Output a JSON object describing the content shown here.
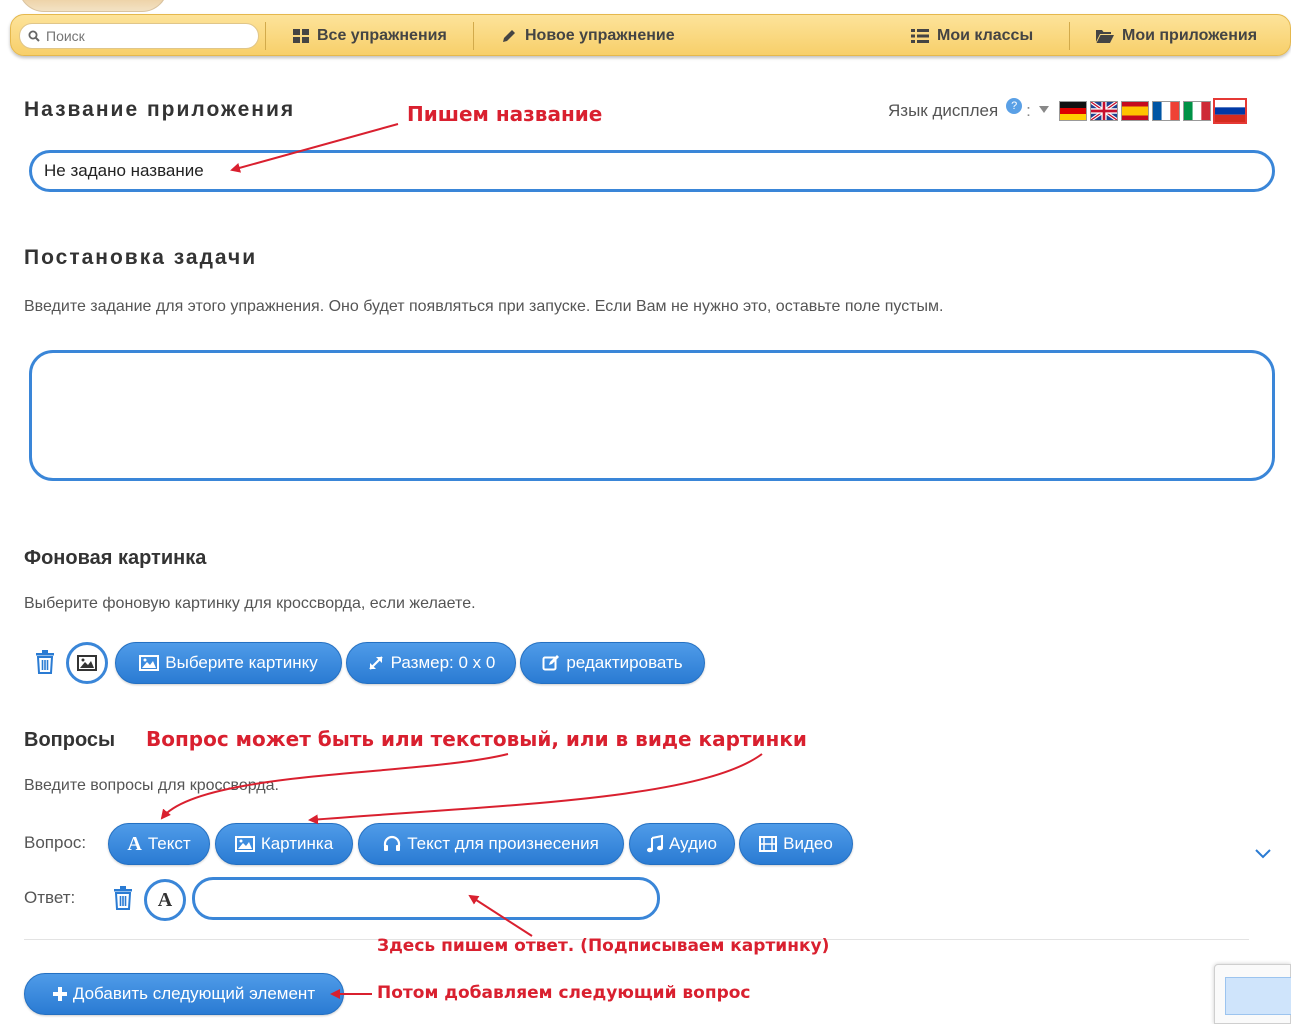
{
  "nav": {
    "search_placeholder": "Поиск",
    "all_exercises": "Все упражнения",
    "new_exercise": "Новое упражнение",
    "my_classes": "Мои классы",
    "my_apps": "Мои приложения"
  },
  "app_name": {
    "heading": "Название приложения",
    "value": "Не задано название"
  },
  "display_language": {
    "label": "Язык дисплея",
    "help": "?",
    "flags": [
      "german-flag",
      "british-flag",
      "spanish-flag",
      "french-flag",
      "italian-flag",
      "russian-flag"
    ]
  },
  "task": {
    "heading": "Постановка задачи",
    "description": "Введите задание для этого упражнения. Оно будет появляться при запуске. Если Вам не нужно это, оставьте поле пустым.",
    "value": ""
  },
  "background": {
    "heading": "Фоновая картинка",
    "description": "Выберите фоновую картинку для кроссворда, если желаете.",
    "choose_label": "Выберите картинку",
    "size_label": "Размер: 0 x 0",
    "edit_label": "редактировать"
  },
  "questions": {
    "heading": "Вопросы",
    "description": "Введите вопросы для кроссворда.",
    "question_label": "Вопрос:",
    "answer_label": "Ответ:",
    "buttons": {
      "text": "Текст",
      "text_glyph": "A",
      "image": "Картинка",
      "speech": "Текст для произнесения",
      "audio": "Аудио",
      "video": "Видео"
    },
    "answer_value": "",
    "answer_format_glyph": "A",
    "add_next": "Добавить следующий элемент"
  },
  "annotations": {
    "write_name": "Пишем название",
    "question_type": "Вопрос может быть или текстовый, или в виде картинки",
    "write_answer": "Здесь пишем ответ. (Подписываем картинку)",
    "add_next_question": "Потом добавляем следующий вопрос"
  },
  "colors": {
    "accent": "#2a7bd3",
    "navbar": "#f7cf6a",
    "annotation": "#d9202f"
  }
}
